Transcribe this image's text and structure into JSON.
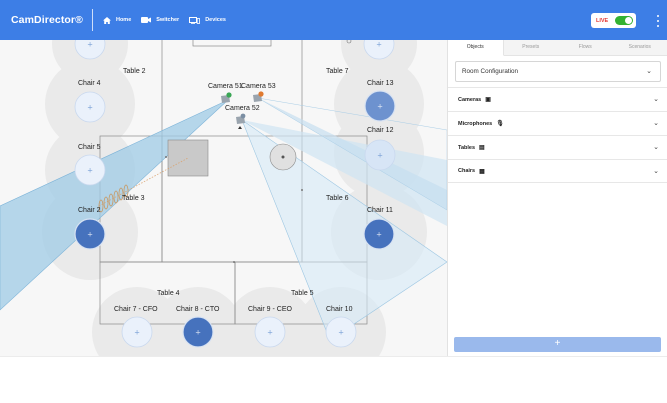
{
  "header": {
    "brand": "CamDirector®",
    "nav": [
      {
        "label": "Home",
        "icon": "home-icon"
      },
      {
        "label": "Switcher",
        "icon": "switcher-icon"
      },
      {
        "label": "Devices",
        "icon": "devices-icon"
      }
    ],
    "live_label": "LIVE",
    "live_on": true,
    "accent_color": "#3d7ee6",
    "live_color": "#34b233"
  },
  "room": {
    "tables": [
      "Table 2",
      "Table 7",
      "Table 3",
      "Table 6",
      "Table 4",
      "Table 5"
    ],
    "cameras": [
      "Camera 51",
      "Camera 53",
      "Camera 52"
    ],
    "chairs": [
      "Chair 4",
      "Chair 13",
      "Chair 12",
      "Chair 5",
      "Chair 2",
      "Chair 11",
      "Chair 7 - CFO",
      "Chair 8 - CTO",
      "Chair 9 - CEO",
      "Chair 10"
    ],
    "chair_color_selected": "#4a78c4",
    "chair_color_default": "#e8f0fb"
  },
  "panel": {
    "tabs": [
      "Objects",
      "Presets",
      "Flows",
      "Scenarios"
    ],
    "active_tab": "Objects",
    "configuration": "Room Configuration",
    "sections": [
      {
        "label": "Cameras",
        "icon": "camera-icon"
      },
      {
        "label": "Microphones",
        "icon": "microphone-icon"
      },
      {
        "label": "Tables",
        "icon": "table-icon"
      },
      {
        "label": "Chairs",
        "icon": "chair-icon"
      }
    ],
    "add_label": "+"
  }
}
